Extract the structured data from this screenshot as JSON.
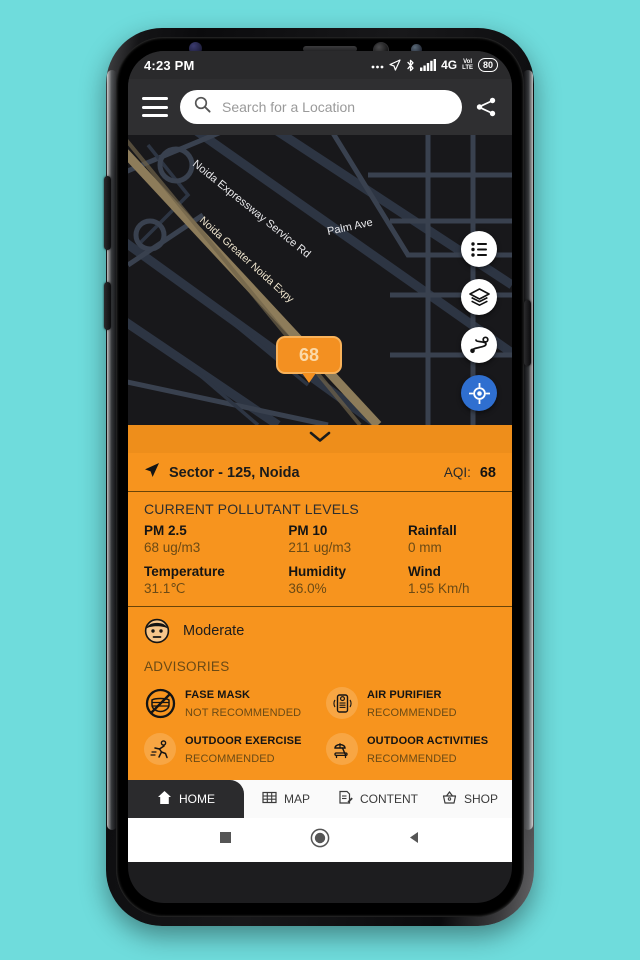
{
  "status_bar": {
    "time": "4:23 PM",
    "icons": [
      "more-dots-icon",
      "location-arrow-icon",
      "bluetooth-icon",
      "signal-bars-icon",
      "4g-icon",
      "volte-icon"
    ],
    "network_label": "4G",
    "volte_top": "VoI",
    "volte_bottom": "LTE",
    "battery_level": "80"
  },
  "header": {
    "menu_icon": "hamburger-menu-icon",
    "search_placeholder": "Search for a Location",
    "search_value": "",
    "search_icon": "search-icon",
    "share_icon": "share-icon"
  },
  "map": {
    "labels": [
      {
        "text": "Noida Expressway Service Rd"
      },
      {
        "text": "Palm Ave"
      },
      {
        "text": "Noida Greater Noida Expy"
      }
    ],
    "marker_value": "68",
    "fabs": [
      {
        "name": "list-icon"
      },
      {
        "name": "layers-icon"
      },
      {
        "name": "route-icon"
      },
      {
        "name": "my-location-icon"
      }
    ],
    "accent_blue": "#2f6fd0"
  },
  "panel": {
    "collapse_icon": "chevron-down-icon",
    "location_icon": "navigation-arrow-icon",
    "location_name": "Sector - 125, Noida",
    "aqi_label": "AQI:",
    "aqi_value": "68",
    "pollutant_title": "CURRENT POLLUTANT LEVELS",
    "metrics_row1": [
      {
        "label": "PM 2.5",
        "value": "68 ug/m3"
      },
      {
        "label": "PM 10",
        "value": "211 ug/m3"
      },
      {
        "label": "Rainfall",
        "value": "0 mm"
      }
    ],
    "metrics_row2": [
      {
        "label": "Temperature",
        "value": "31.1℃"
      },
      {
        "label": "Humidity",
        "value": "36.0%"
      },
      {
        "label": "Wind",
        "value": "1.95 Km/h"
      }
    ],
    "status_face_icon": "neutral-face-icon",
    "status_text": "Moderate",
    "advisories_title": "ADVISORIES",
    "advisories": [
      {
        "icon": "face-mask-prohibited-icon",
        "name": "FASE MASK",
        "status": "NOT RECOMMENDED"
      },
      {
        "icon": "air-purifier-icon",
        "name": "AIR PURIFIER",
        "status": "RECOMMENDED"
      },
      {
        "icon": "running-person-icon",
        "name": "OUTDOOR EXERCISE",
        "status": "RECOMMENDED"
      },
      {
        "icon": "beach-umbrella-icon",
        "name": "OUTDOOR ACTIVITIES",
        "status": "RECOMMENDED"
      }
    ],
    "background_color": "#F7941E"
  },
  "bottom_nav": {
    "items": [
      {
        "label": "HOME",
        "icon": "home-icon",
        "active": true
      },
      {
        "label": "MAP",
        "icon": "grid-map-icon",
        "active": false
      },
      {
        "label": "CONTENT",
        "icon": "document-edit-icon",
        "active": false
      },
      {
        "label": "SHOP",
        "icon": "basket-icon",
        "active": false
      }
    ]
  },
  "android_nav": {
    "buttons": [
      {
        "name": "recents-square-icon"
      },
      {
        "name": "home-circle-icon"
      },
      {
        "name": "back-triangle-icon"
      }
    ]
  }
}
